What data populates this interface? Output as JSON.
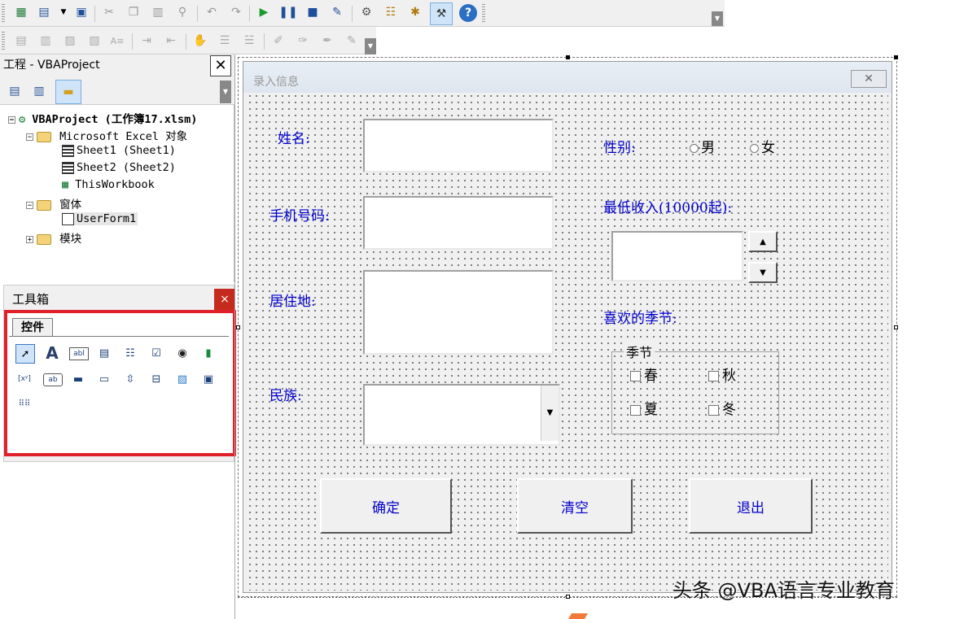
{
  "project_pane": {
    "title": "工程 - VBAProject",
    "close": "✕",
    "tree": {
      "root": "VBAProject (工作簿17.xlsm)",
      "excel_objects": "Microsoft Excel 对象",
      "sheet1": "Sheet1 (Sheet1)",
      "sheet2": "Sheet2 (Sheet2)",
      "workbook": "ThisWorkbook",
      "forms_folder": "窗体",
      "userform": "UserForm1",
      "modules_folder": "模块"
    }
  },
  "toolbox": {
    "title": "工具箱",
    "close": "×",
    "tab": "控件",
    "tools": [
      "pointer-icon",
      "label-icon",
      "textbox-icon",
      "combobox-icon",
      "listbox-icon",
      "checkbox-icon",
      "optionbutton-icon",
      "togglebutton-icon",
      "frame-icon",
      "commandbutton-icon",
      "tabstrip-icon",
      "multipage-icon",
      "scrollbar-icon",
      "spinbutton-icon",
      "image-icon",
      "refedit-icon",
      "more-controls-icon"
    ],
    "highlight_color": "#e0202a"
  },
  "form": {
    "title": "录入信息",
    "labels": {
      "name": "姓名:",
      "phone": "手机号码:",
      "address": "居住地:",
      "ethnicity": "民族:",
      "gender": "性别:",
      "min_income": "最低收入(10000起):",
      "season_pref": "喜欢的季节:"
    },
    "gender_options": {
      "male": "男",
      "female": "女"
    },
    "frame": {
      "caption": "季节",
      "spring": "春",
      "autumn": "秋",
      "summer": "夏",
      "winter": "冬"
    },
    "buttons": {
      "ok": "确定",
      "clear": "清空",
      "exit": "退出"
    },
    "label_color": "#0000cc"
  },
  "watermark": "头条 @VBA语言专业教育"
}
